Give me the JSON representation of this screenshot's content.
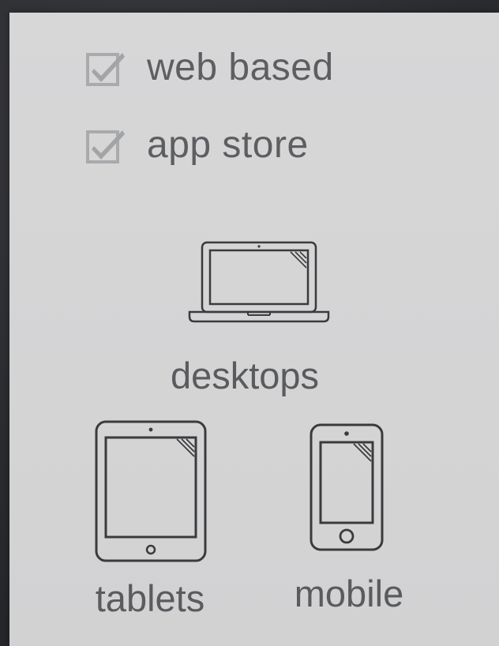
{
  "options": [
    {
      "label": "web based",
      "checked": true
    },
    {
      "label": "app store",
      "checked": true
    }
  ],
  "devices": {
    "desktop": {
      "label": "desktops",
      "icon": "laptop-icon"
    },
    "tablet": {
      "label": "tablets",
      "icon": "tablet-icon"
    },
    "mobile": {
      "label": "mobile",
      "icon": "phone-icon"
    }
  },
  "colors": {
    "panel": "#d4d4d5",
    "text": "#5c5d60",
    "icon_stroke": "#3a3b3d",
    "checkbox": "#a9aaac",
    "background": "#2e2f33"
  }
}
